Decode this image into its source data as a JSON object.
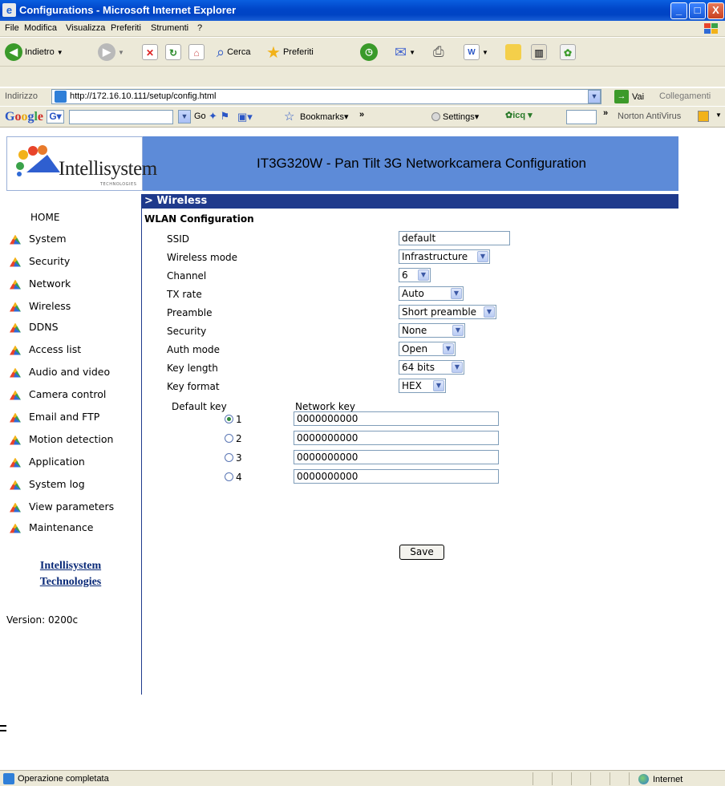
{
  "window": {
    "title": "Configurations - Microsoft Internet Explorer",
    "controls": [
      "_",
      "□",
      "X"
    ]
  },
  "menubar": {
    "items": [
      "File",
      "Modifica",
      "Visualizza",
      "Preferiti",
      "Strumenti",
      "?"
    ]
  },
  "toolbar": {
    "back_label": "Indietro",
    "search_label": "Cerca",
    "favorites_label": "Preferiti"
  },
  "address": {
    "label": "Indirizzo",
    "url": "http://172.16.10.111/setup/config.html",
    "go_label": "Vai",
    "links_label": "Collegamenti"
  },
  "googlebar": {
    "go_label": "Go",
    "bookmarks_label": "Bookmarks",
    "settings_label": "Settings",
    "icq_label": "icq",
    "norton_label": "Norton AntiVirus"
  },
  "banner": {
    "logo_text": "Intellisystem",
    "logo_sub": "TECHNOLOGIES",
    "title": "IT3G320W - Pan Tilt 3G Networkcamera Configuration"
  },
  "section": {
    "title": "> Wireless"
  },
  "sidebar": {
    "home": "HOME",
    "items": [
      "System",
      "Security",
      "Network",
      "Wireless",
      "DDNS",
      "Access list",
      "Audio and video",
      "Camera control",
      "Email and FTP",
      "Motion detection",
      "Application",
      "System log",
      "View parameters",
      "Maintenance"
    ],
    "company_line1": "Intellisystem",
    "company_line2": "Technologies",
    "version": "Version: 0200c"
  },
  "form": {
    "title": "WLAN Configuration",
    "ssid": {
      "label": "SSID",
      "value": "default"
    },
    "wireless_mode": {
      "label": "Wireless mode",
      "value": "Infrastructure"
    },
    "channel": {
      "label": "Channel",
      "value": "6"
    },
    "tx_rate": {
      "label": "TX rate",
      "value": "Auto"
    },
    "preamble": {
      "label": "Preamble",
      "value": "Short preamble"
    },
    "security": {
      "label": "Security",
      "value": "None"
    },
    "auth_mode": {
      "label": "Auth mode",
      "value": "Open"
    },
    "key_length": {
      "label": "Key length",
      "value": "64 bits"
    },
    "key_format": {
      "label": "Key format",
      "value": "HEX"
    },
    "default_key_label": "Default key",
    "network_key_label": "Network key",
    "keys": [
      {
        "num": "1",
        "value": "0000000000",
        "selected": true
      },
      {
        "num": "2",
        "value": "0000000000",
        "selected": false
      },
      {
        "num": "3",
        "value": "0000000000",
        "selected": false
      },
      {
        "num": "4",
        "value": "0000000000",
        "selected": false
      }
    ],
    "save_label": "Save"
  },
  "statusbar": {
    "text": "Operazione completata",
    "zone": "Internet"
  }
}
